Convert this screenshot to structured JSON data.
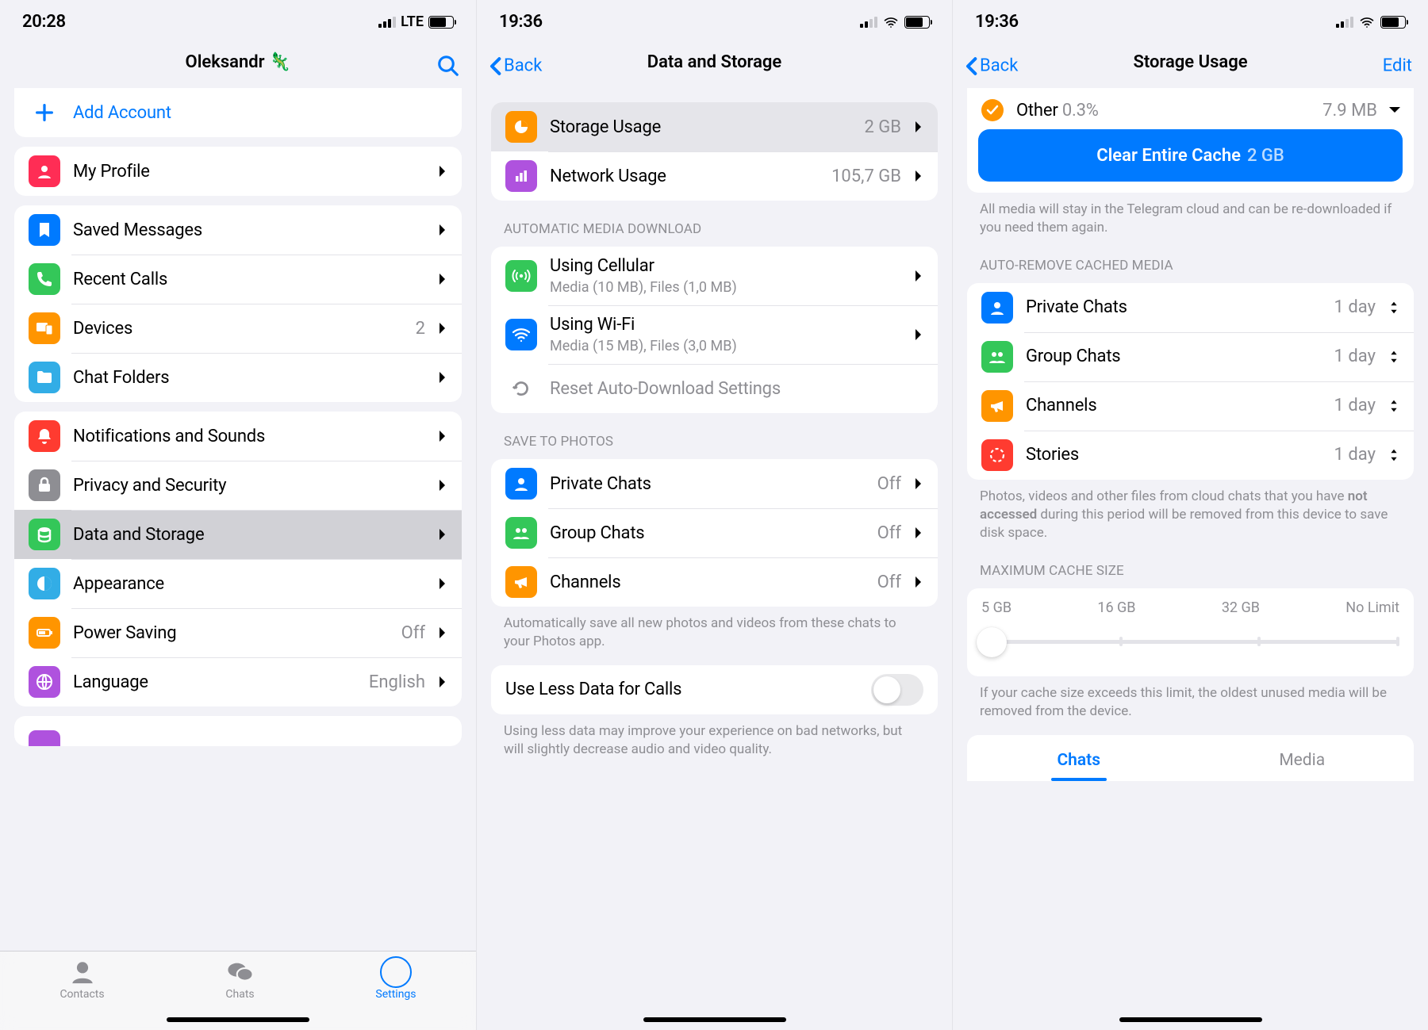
{
  "p1": {
    "status": {
      "time": "20:28",
      "net": "LTE",
      "battery_pct": 65
    },
    "title": "Oleksandr 🦎",
    "add_account": "Add Account",
    "my_profile": "My Profile",
    "cells": {
      "saved": "Saved Messages",
      "calls": "Recent Calls",
      "devices": "Devices",
      "devices_count": "2",
      "folders": "Chat Folders",
      "notif": "Notifications and Sounds",
      "privacy": "Privacy and Security",
      "data": "Data and Storage",
      "appearance": "Appearance",
      "power": "Power Saving",
      "power_val": "Off",
      "language": "Language",
      "language_val": "English"
    },
    "tabs": {
      "contacts": "Contacts",
      "chats": "Chats",
      "settings": "Settings"
    }
  },
  "p2": {
    "status": {
      "time": "19:36",
      "battery_pct": 71
    },
    "back": "Back",
    "title": "Data and Storage",
    "storage": {
      "label": "Storage Usage",
      "value": "2 GB"
    },
    "network": {
      "label": "Network Usage",
      "value": "105,7 GB"
    },
    "auto_dl_header": "AUTOMATIC MEDIA DOWNLOAD",
    "cellular": {
      "label": "Using Cellular",
      "sub": "Media (10 MB), Files (1,0 MB)"
    },
    "wifi": {
      "label": "Using Wi-Fi",
      "sub": "Media (15 MB), Files (3,0 MB)"
    },
    "reset": "Reset Auto-Download Settings",
    "save_header": "SAVE TO PHOTOS",
    "private": "Private Chats",
    "group": "Group Chats",
    "channels": "Channels",
    "off": "Off",
    "save_footer": "Automatically save all new photos and videos from these chats to your Photos app.",
    "less_data": "Use Less Data for Calls",
    "less_data_footer": "Using less data may improve your experience on bad networks, but will slightly decrease audio and video quality."
  },
  "p3": {
    "status": {
      "time": "19:36",
      "battery_pct": 71
    },
    "back": "Back",
    "title": "Storage Usage",
    "edit": "Edit",
    "other_label": "Other",
    "other_pct": "0.3%",
    "other_size": "7.9 MB",
    "clear_prefix": "Clear Entire Cache",
    "clear_size": "2 GB",
    "clear_footer": "All media will stay in the Telegram cloud and can be re-downloaded if you need them again.",
    "auto_remove_header": "AUTO-REMOVE CACHED MEDIA",
    "autoremove": {
      "private": "Private Chats",
      "group": "Group Chats",
      "channels": "Channels",
      "stories": "Stories",
      "value": "1 day"
    },
    "auto_footer_1": "Photos, videos and other files from cloud chats that you have ",
    "auto_footer_strong": "not accessed",
    "auto_footer_2": " during this period will be removed from this device to save disk space.",
    "max_header": "MAXIMUM CACHE SIZE",
    "slider_labels": [
      "5 GB",
      "16 GB",
      "32 GB",
      "No Limit"
    ],
    "max_footer": "If your cache size exceeds this limit, the oldest unused media will be removed from the device.",
    "seg_chats": "Chats",
    "seg_media": "Media"
  }
}
